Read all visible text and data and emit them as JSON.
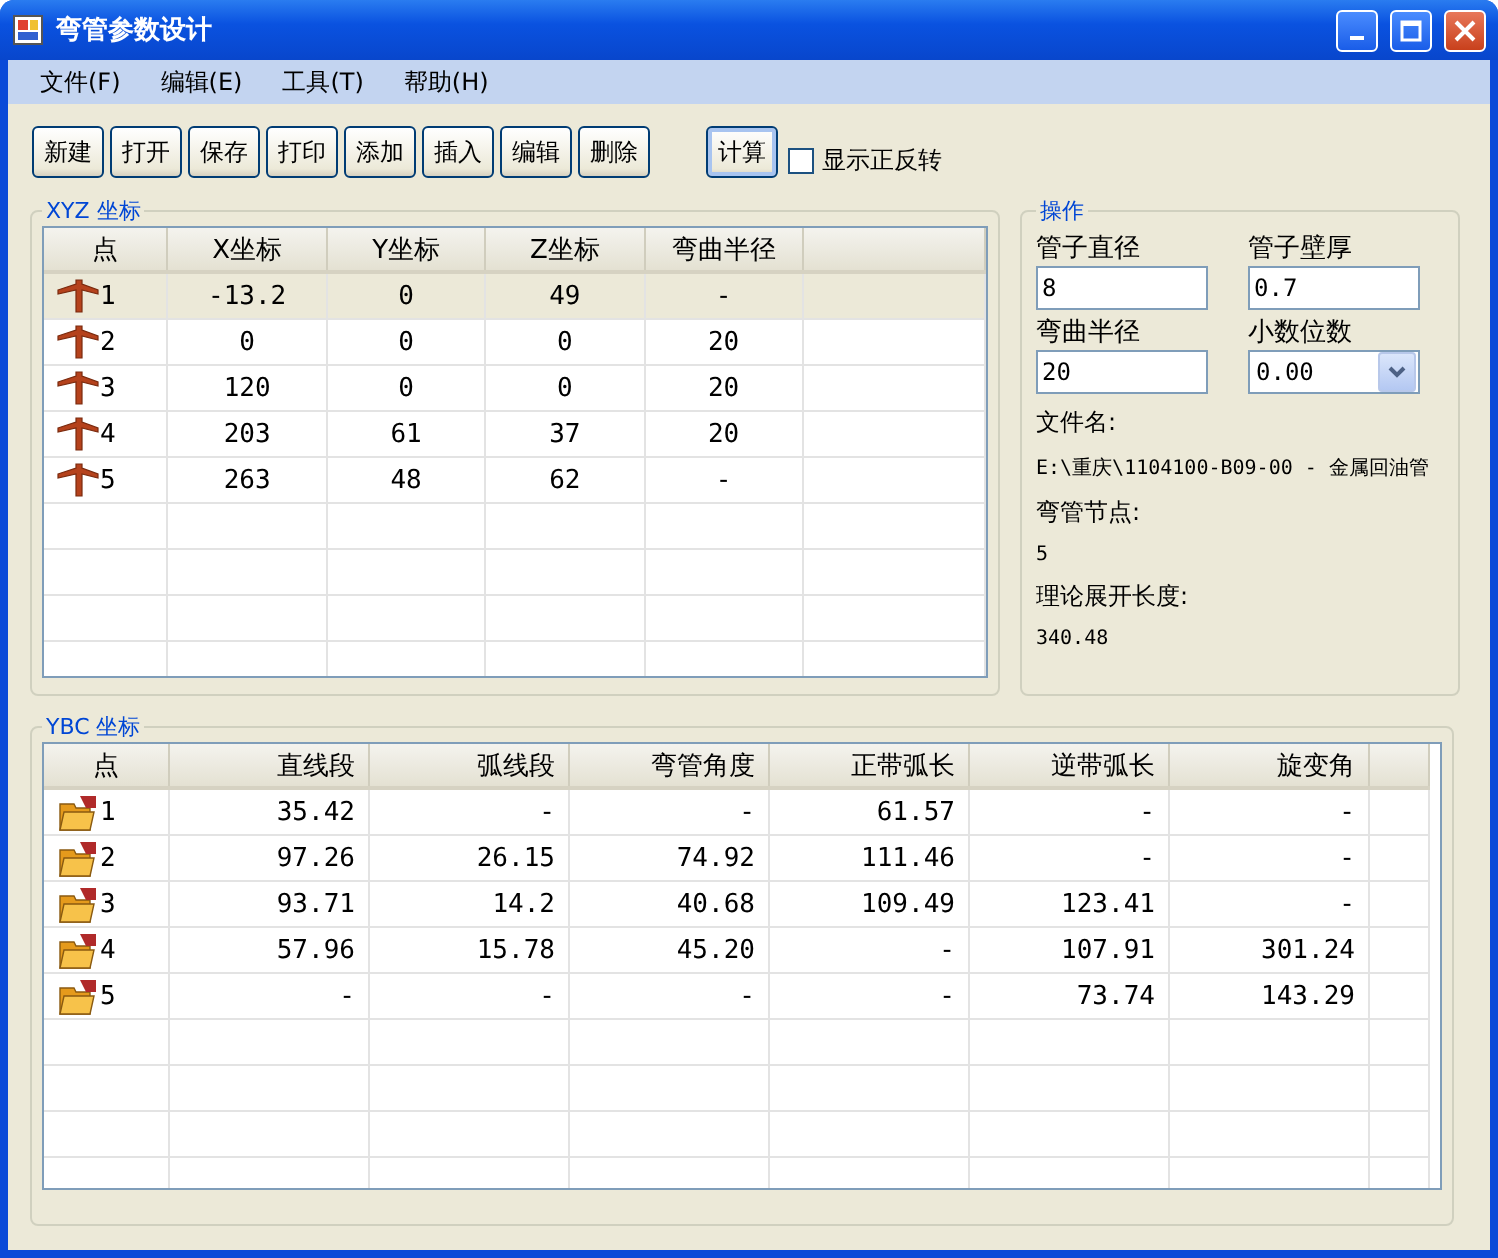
{
  "window": {
    "title": "弯管参数设计"
  },
  "menu": [
    "文件(F)",
    "编辑(E)",
    "工具(T)",
    "帮助(H)"
  ],
  "toolbar": {
    "buttons": [
      "新建",
      "打开",
      "保存",
      "打印",
      "添加",
      "插入",
      "编辑",
      "删除"
    ],
    "action_button": "计算",
    "checkbox": {
      "label": "显示正反转",
      "checked": false
    }
  },
  "xyz": {
    "title": "XYZ 坐标",
    "columns": [
      "点",
      "X坐标",
      "Y坐标",
      "Z坐标",
      "弯曲半径"
    ],
    "rows": [
      {
        "cells": [
          "1",
          "-13.2",
          "0",
          "49",
          "-"
        ],
        "selected": true
      },
      {
        "cells": [
          "2",
          "0",
          "0",
          "0",
          "20"
        ],
        "selected": false
      },
      {
        "cells": [
          "3",
          "120",
          "0",
          "0",
          "20"
        ],
        "selected": false
      },
      {
        "cells": [
          "4",
          "203",
          "61",
          "37",
          "20"
        ],
        "selected": false
      },
      {
        "cells": [
          "5",
          "263",
          "48",
          "62",
          "-"
        ],
        "selected": false
      }
    ]
  },
  "operation": {
    "title": "操作",
    "fields": [
      {
        "label": "管子直径",
        "value": "8",
        "kind": "text"
      },
      {
        "label": "管子壁厚",
        "value": "0.7",
        "kind": "text"
      },
      {
        "label": "弯曲半径",
        "value": "20",
        "kind": "text"
      },
      {
        "label": "小数位数",
        "value": "0.00",
        "kind": "dropdown"
      }
    ],
    "info": [
      {
        "label": "文件名:",
        "value": "E:\\重庆\\1104100-B09-00 - 金属回油管"
      },
      {
        "label": "弯管节点:",
        "value": "5"
      },
      {
        "label": "理论展开长度:",
        "value": "340.48"
      }
    ]
  },
  "ybc": {
    "title": "YBC 坐标",
    "columns": [
      "点",
      "直线段",
      "弧线段",
      "弯管角度",
      "正带弧长",
      "逆带弧长",
      "旋变角"
    ],
    "rows": [
      {
        "cells": [
          "1",
          "35.42",
          "-",
          "-",
          "61.57",
          "-",
          "-"
        ],
        "selected": false
      },
      {
        "cells": [
          "2",
          "97.26",
          "26.15",
          "74.92",
          "111.46",
          "-",
          "-"
        ],
        "selected": false
      },
      {
        "cells": [
          "3",
          "93.71",
          "14.2",
          "40.68",
          "109.49",
          "123.41",
          "-"
        ],
        "selected": false
      },
      {
        "cells": [
          "4",
          "57.96",
          "15.78",
          "45.20",
          "-",
          "107.91",
          "301.24"
        ],
        "selected": false
      },
      {
        "cells": [
          "5",
          "-",
          "-",
          "-",
          "-",
          "73.74",
          "143.29"
        ],
        "selected": false
      }
    ]
  }
}
